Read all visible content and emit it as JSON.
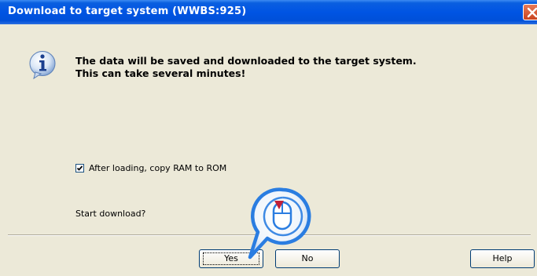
{
  "window": {
    "title": "Download to target system (WWBS:925)"
  },
  "message": {
    "line1": "The data will be saved and downloaded to the target system.",
    "line2": "This can take several minutes!"
  },
  "option": {
    "label": "After loading, copy RAM to ROM",
    "checked": true
  },
  "prompt": "Start download?",
  "buttons": {
    "yes": "Yes",
    "no": "No",
    "help": "Help"
  },
  "icons": {
    "info": "info-icon",
    "close": "close-icon",
    "mouse_click": "mouse-click-icon"
  },
  "colors": {
    "titlebar": "#0054e3",
    "dialog_bg": "#ece9d8",
    "close_button": "#d9532c",
    "pointer_highlight": "#2a7de1"
  }
}
